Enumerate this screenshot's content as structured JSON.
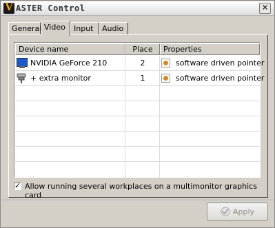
{
  "window": {
    "title": "ASTER Control",
    "logo_letter": "V",
    "close_glyph": "✕"
  },
  "tabs": [
    {
      "label": "General",
      "active": false
    },
    {
      "label": "Video",
      "active": true
    },
    {
      "label": "Input",
      "active": false
    },
    {
      "label": "Audio",
      "active": false
    }
  ],
  "devices": {
    "columns": [
      "Device name",
      "Place",
      "Properties"
    ],
    "rows": [
      {
        "name": "NVIDIA GeForce 210",
        "place": "2",
        "properties": "software driven pointer",
        "icon": "monitor-icon"
      },
      {
        "name": "+ extra monitor",
        "place": "1",
        "properties": "software driven pointer",
        "icon": "plug-icon"
      }
    ]
  },
  "options": {
    "multi_workplace_label": "Allow running several workplaces on a multimonitor graphics card",
    "multi_workplace_checked": true,
    "check_glyph": "✓"
  },
  "buttons": {
    "apply_label": "Apply",
    "apply_enabled": false
  },
  "colors": {
    "window_bg": "#d4d0c8",
    "logo_accent": "#f7a21b",
    "disabled_text": "#8d8d8d"
  }
}
